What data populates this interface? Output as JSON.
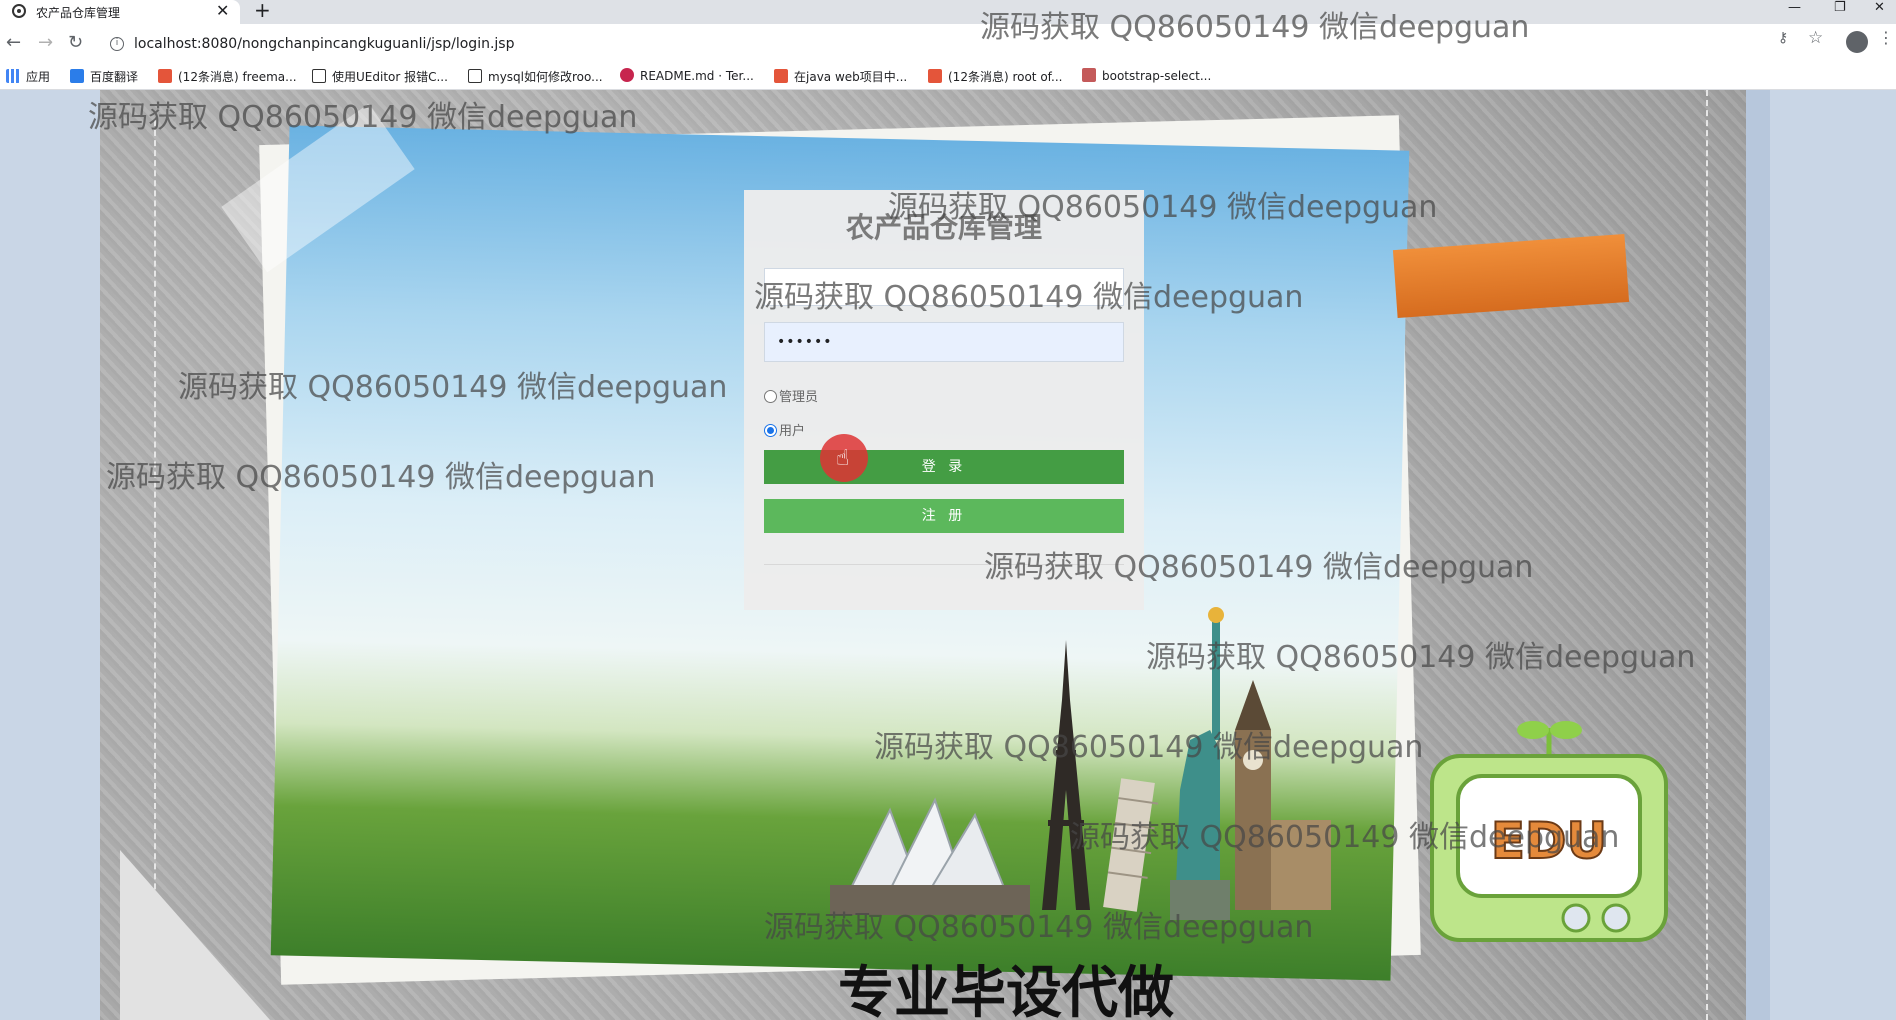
{
  "browser": {
    "tab_title": "农产品仓库管理",
    "tab_close": "✕",
    "new_tab": "+",
    "url": "localhost:8080/nongchanpincangkuguanli/jsp/login.jsp",
    "bookmarks": [
      {
        "label": "应用",
        "color": "#4285f4"
      },
      {
        "label": "百度翻译",
        "color": "#2b7de9"
      },
      {
        "label": "(12条消息) freema...",
        "color": "#e4553a"
      },
      {
        "label": "使用UEditor 报错C...",
        "color": "#333333"
      },
      {
        "label": "mysql如何修改roo...",
        "color": "#333333"
      },
      {
        "label": "README.md · Ter...",
        "color": "#c7254e"
      },
      {
        "label": "在java web项目中...",
        "color": "#e4553a"
      },
      {
        "label": "(12条消息) root of...",
        "color": "#e4553a"
      },
      {
        "label": "bootstrap-select...",
        "color": "#c45a5a"
      }
    ]
  },
  "login": {
    "title": "农产品仓库管理",
    "username_value": "",
    "password_mask": "••••••",
    "role_admin": "管理员",
    "role_user": "用户",
    "selected_role": "用户",
    "login_button": "登 录",
    "register_button": "注 册"
  },
  "sticker": {
    "text": "EDU"
  },
  "watermark_text": "源码获取 QQ86050149 微信deepguan",
  "banner": "专业毕设代做",
  "colors": {
    "login_button": "#449d44",
    "register_button": "#5cb85c",
    "tape": "#e8822f"
  }
}
